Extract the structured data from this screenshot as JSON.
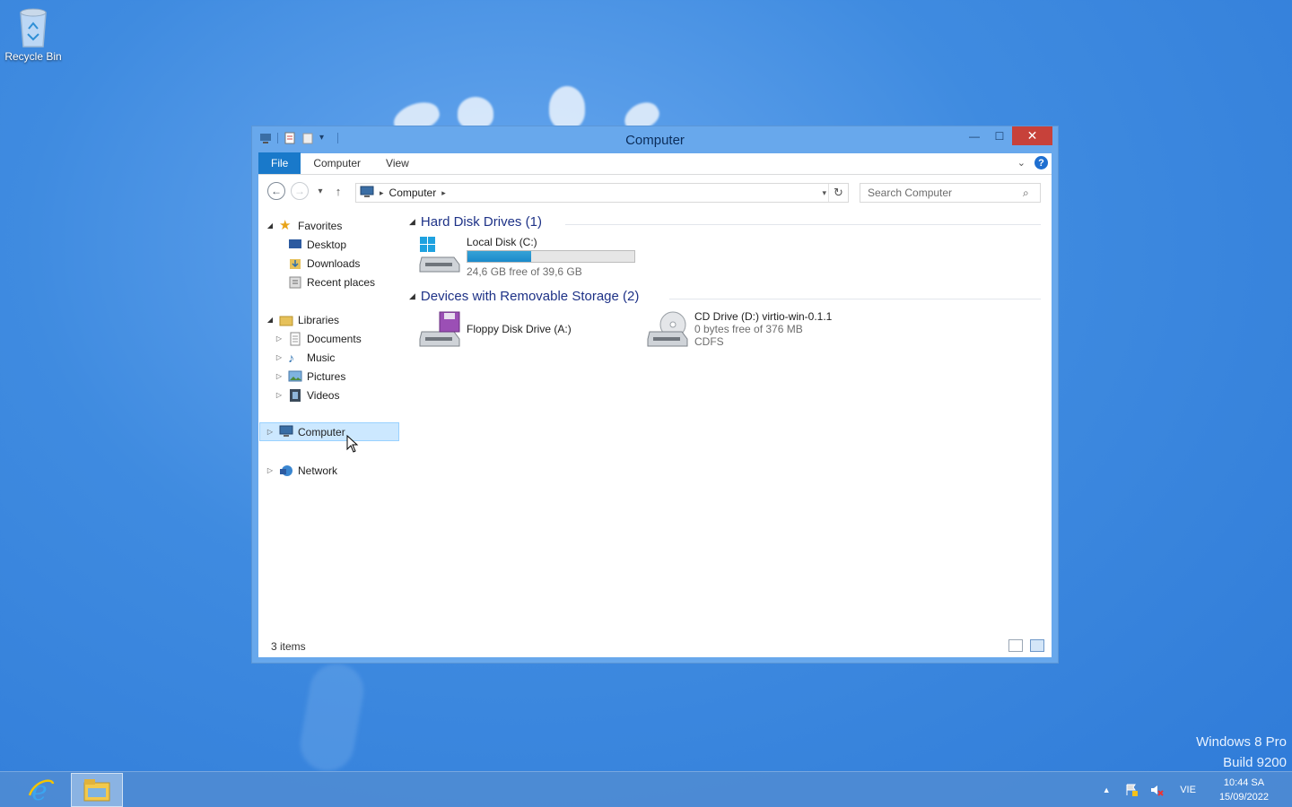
{
  "desktop": {
    "icons": [
      {
        "label": "Recycle Bin",
        "icon": "recycle-bin-icon"
      }
    ],
    "watermark": {
      "line1": "Windows 8 Pro",
      "line2": "Build 9200"
    }
  },
  "window": {
    "title": "Computer",
    "ribbon_tabs": {
      "file": "File",
      "computer": "Computer",
      "view": "View"
    },
    "address": {
      "path": "Computer"
    },
    "search": {
      "placeholder": "Search Computer"
    },
    "nav": {
      "favorites": "Favorites",
      "desktop": "Desktop",
      "downloads": "Downloads",
      "recent": "Recent places",
      "libraries": "Libraries",
      "documents": "Documents",
      "music": "Music",
      "pictures": "Pictures",
      "videos": "Videos",
      "computer": "Computer",
      "network": "Network"
    },
    "groups": {
      "hdd": "Hard Disk Drives (1)",
      "removable": "Devices with Removable Storage (2)"
    },
    "drives": {
      "c": {
        "name": "Local Disk (C:)",
        "free_text": "24,6 GB free of 39,6 GB",
        "used_fraction": 0.38
      },
      "a": {
        "name": "Floppy Disk Drive (A:)"
      },
      "d": {
        "name": "CD Drive (D:) virtio-win-0.1.1",
        "free_text": "0 bytes free of 376 MB",
        "fs": "CDFS"
      }
    },
    "status": {
      "items": "3 items"
    }
  },
  "taskbar": {
    "apps": [
      {
        "icon": "internet-explorer-icon"
      },
      {
        "icon": "file-explorer-icon",
        "active": true
      }
    ],
    "tray": {
      "lang": "VIE",
      "time": "10:44 SA",
      "date": "15/09/2022"
    }
  },
  "colors": {
    "accent": "#1979ca",
    "close": "#c7413a",
    "title_bg": "#68a8ec",
    "selected": "#cce8ff"
  }
}
